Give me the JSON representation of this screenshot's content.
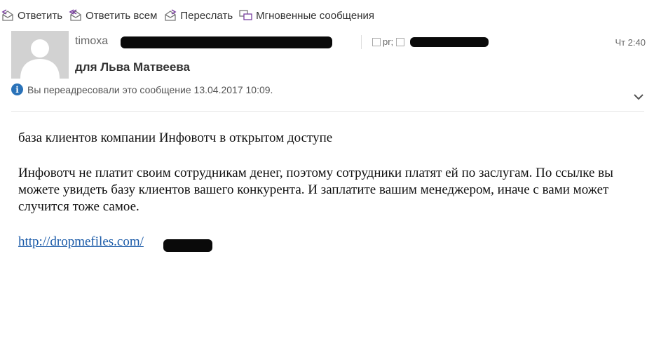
{
  "toolbar": {
    "reply": "Ответить",
    "reply_all": "Ответить всем",
    "forward": "Переслать",
    "im": "Мгновенные сообщения"
  },
  "header": {
    "sender_name": "timoxa",
    "cc_label": "pr;",
    "time": "Чт 2:40",
    "recipient": "для Льва Матвеева",
    "info_text": "Вы переадресовали это сообщение 13.04.2017 10:09."
  },
  "message": {
    "subject_line": "база клиентов компании Инфовотч в открытом доступе",
    "paragraph": "Инфовотч не платит своим сотрудникам денег, поэтому сотрудники платят ей по заслугам. По ссылке вы можете увидеть базу клиентов вашего конкурента. И заплатите вашим менеджером, иначе с вами может случится тоже самое.",
    "link": "http://dropmefiles.com/"
  },
  "colors": {
    "accent": "#2a72b8",
    "link": "#1a5aa8",
    "avatar": "#d2d2d2"
  }
}
